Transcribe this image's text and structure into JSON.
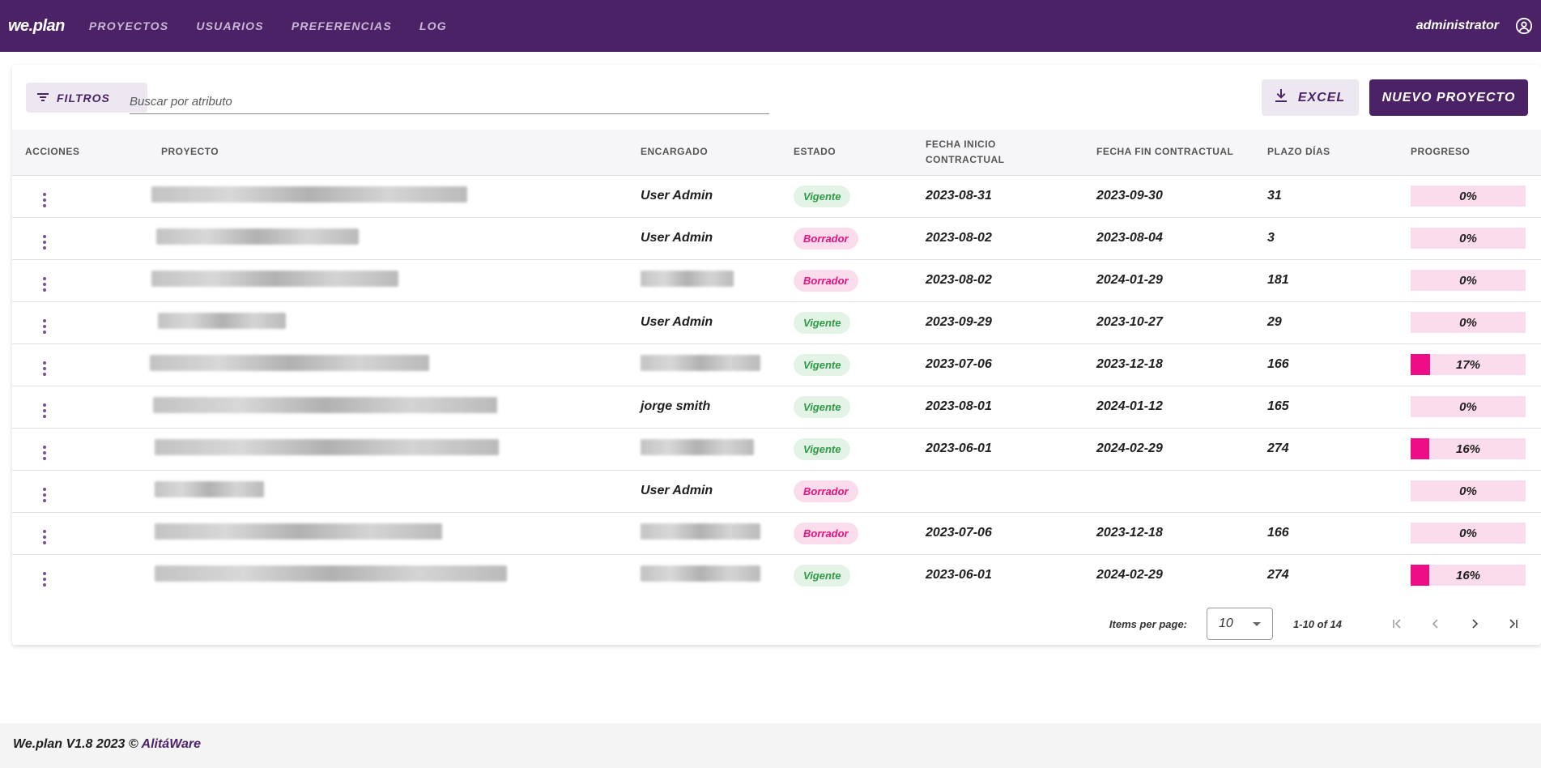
{
  "header": {
    "brand": "we.plan",
    "nav": [
      "PROYECTOS",
      "USUARIOS",
      "PREFERENCIAS",
      "LOG"
    ],
    "user": "administrator"
  },
  "toolbar": {
    "filter_label": "FILTROS",
    "search_placeholder": "Buscar por atributo",
    "excel_label": "EXCEL",
    "new_label": "NUEVO PROYECTO"
  },
  "table": {
    "headers": {
      "acciones": "ACCIONES",
      "proyecto": "PROYECTO",
      "encargado": "ENCARGADO",
      "estado": "ESTADO",
      "inicio_1": "FECHA INICIO",
      "inicio_2": "CONTRACTUAL",
      "fin": "FECHA FIN CONTRACTUAL",
      "plazo": "PLAZO DÍAS",
      "progreso": "PROGRESO"
    },
    "rows": [
      {
        "encargado": "User Admin",
        "estado": "Vigente",
        "inicio": "2023-08-31",
        "fin": "2023-09-30",
        "plazo": "31",
        "progreso": "0%",
        "progress_value": 0
      },
      {
        "encargado": "User Admin",
        "estado": "Borrador",
        "inicio": "2023-08-02",
        "fin": "2023-08-04",
        "plazo": "3",
        "progreso": "0%",
        "progress_value": 0
      },
      {
        "encargado": "",
        "estado": "Borrador",
        "inicio": "2023-08-02",
        "fin": "2024-01-29",
        "plazo": "181",
        "progreso": "0%",
        "progress_value": 0
      },
      {
        "encargado": "User Admin",
        "estado": "Vigente",
        "inicio": "2023-09-29",
        "fin": "2023-10-27",
        "plazo": "29",
        "progreso": "0%",
        "progress_value": 0
      },
      {
        "encargado": "",
        "estado": "Vigente",
        "inicio": "2023-07-06",
        "fin": "2023-12-18",
        "plazo": "166",
        "progreso": "17%",
        "progress_value": 17
      },
      {
        "encargado": "jorge smith",
        "estado": "Vigente",
        "inicio": "2023-08-01",
        "fin": "2024-01-12",
        "plazo": "165",
        "progreso": "0%",
        "progress_value": 0
      },
      {
        "encargado": "",
        "estado": "Vigente",
        "inicio": "2023-06-01",
        "fin": "2024-02-29",
        "plazo": "274",
        "progreso": "16%",
        "progress_value": 16
      },
      {
        "encargado": "User Admin",
        "estado": "Borrador",
        "inicio": "",
        "fin": "",
        "plazo": "",
        "progreso": "0%",
        "progress_value": 0
      },
      {
        "encargado": "",
        "estado": "Borrador",
        "inicio": "2023-07-06",
        "fin": "2023-12-18",
        "plazo": "166",
        "progreso": "0%",
        "progress_value": 0
      },
      {
        "encargado": "",
        "estado": "Vigente",
        "inicio": "2023-06-01",
        "fin": "2024-02-29",
        "plazo": "274",
        "progreso": "16%",
        "progress_value": 16
      }
    ]
  },
  "pager": {
    "items_label": "Items per page:",
    "page_size": "10",
    "range": "1-10 of 14"
  },
  "footer": {
    "text": "We.plan V1.8 2023 © ",
    "link": "AlitáWare"
  },
  "colors": {
    "brand": "#4c2266",
    "vigente": "#2e9a46",
    "borrador": "#e4127e",
    "progress": "#ec0d87"
  }
}
